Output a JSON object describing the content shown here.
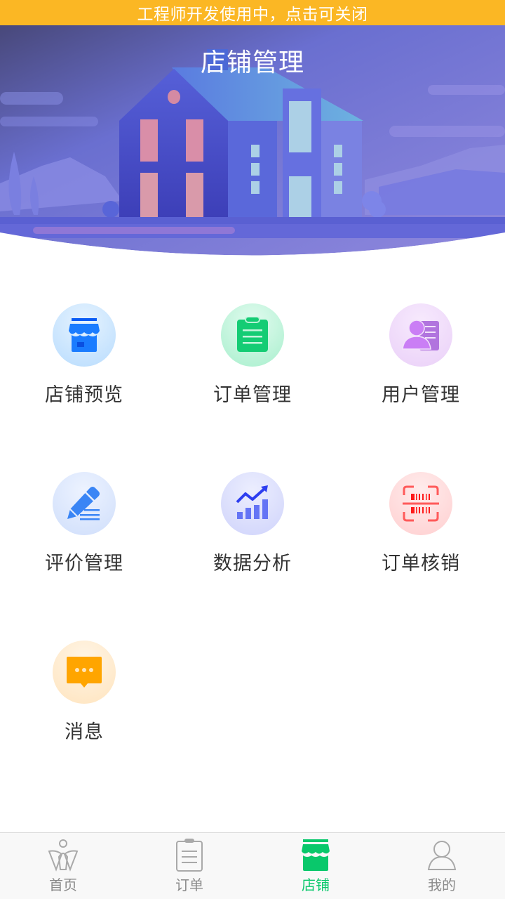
{
  "dev_banner": {
    "text": "工程师开发使用中，点击可关闭"
  },
  "header": {
    "title": "店铺管理"
  },
  "menu": {
    "items": [
      {
        "label": "店铺预览",
        "icon": "store-icon",
        "color": "#1a7cff"
      },
      {
        "label": "订单管理",
        "icon": "clipboard-icon",
        "color": "#14cc74"
      },
      {
        "label": "用户管理",
        "icon": "user-card-icon",
        "color": "#c777f0"
      },
      {
        "label": "评价管理",
        "icon": "pencil-icon",
        "color": "#3a85f5"
      },
      {
        "label": "数据分析",
        "icon": "chart-trend-icon",
        "color": "#5a67f5"
      },
      {
        "label": "订单核销",
        "icon": "barcode-scan-icon",
        "color": "#ff5a5a"
      },
      {
        "label": "消息",
        "icon": "message-icon",
        "color": "#ffa500"
      }
    ]
  },
  "tabbar": {
    "active_color": "#09c86b",
    "inactive_color": "#8a8a8a",
    "tabs": [
      {
        "label": "首页",
        "icon": "home-lotus-icon",
        "active": false
      },
      {
        "label": "订单",
        "icon": "clipboard-icon",
        "active": false
      },
      {
        "label": "店铺",
        "icon": "store-icon",
        "active": true
      },
      {
        "label": "我的",
        "icon": "user-icon",
        "active": false
      }
    ]
  }
}
